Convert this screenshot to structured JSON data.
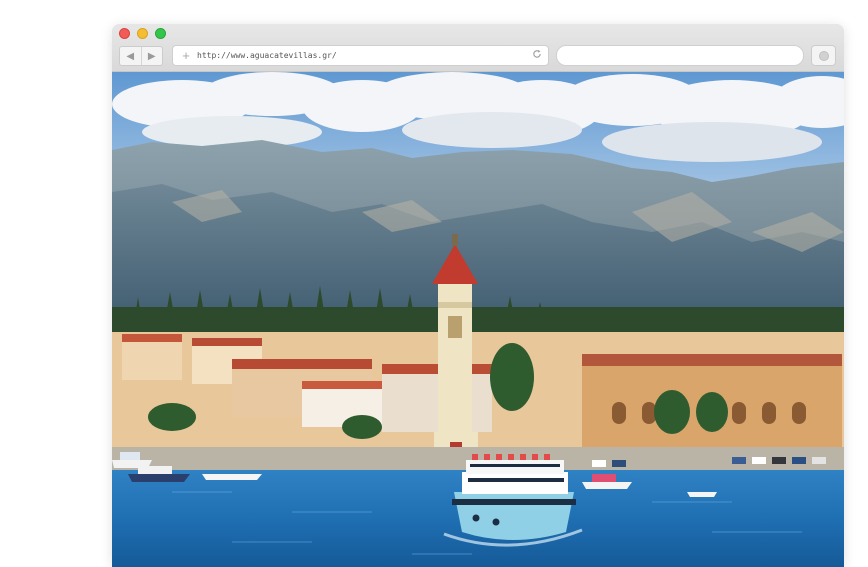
{
  "browser": {
    "address_bar": {
      "url": "http://www.aguacatevillas.gr/"
    },
    "search_bar": {
      "value": ""
    },
    "nav": {
      "back_glyph": "◀",
      "forward_glyph": "▶"
    },
    "icons": {
      "add": "plus-icon",
      "reload": "reload-icon",
      "extension": "circle-icon"
    }
  },
  "page": {
    "image": "harbor-town-photo"
  },
  "colors": {
    "window_red": "#f25b57",
    "window_yellow": "#f5bd30",
    "window_green": "#35c54a",
    "sea": "#1f6fb3",
    "sky": "#6fa6d8"
  }
}
